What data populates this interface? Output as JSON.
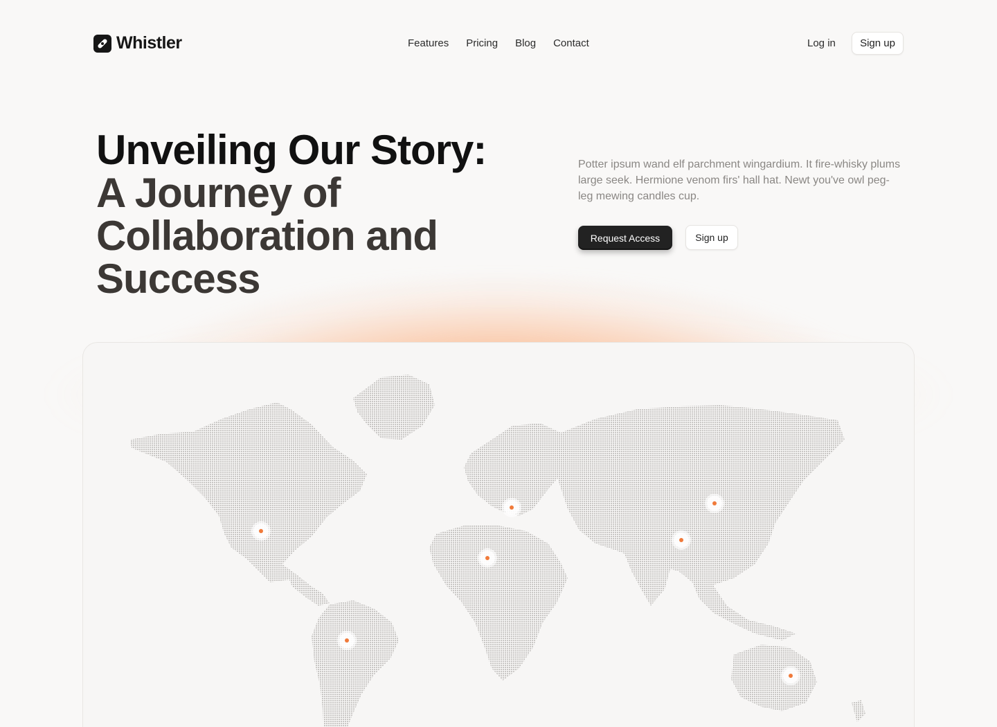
{
  "brand": {
    "name": "Whistler",
    "logo_icon": "bandage-icon"
  },
  "nav": {
    "links": [
      "Features",
      "Pricing",
      "Blog",
      "Contact"
    ],
    "login": "Log in",
    "signup": "Sign up"
  },
  "hero": {
    "title_line1": "Unveiling Our Story:",
    "title_line2": "A Journey of",
    "title_line3": "Collaboration and",
    "title_line4": "Success",
    "description": "Potter ipsum wand elf parchment wingardium. It fire-whisky plums large seek. Hermione venom firs' hall hat. Newt you've owl peg-leg mewing candles cup.",
    "primary_cta": "Request Access",
    "secondary_cta": "Sign up"
  },
  "colors": {
    "accent": "#f07a3a",
    "glow": "#fb965a",
    "dark_button": "#222222",
    "background": "#f9f8f7"
  }
}
